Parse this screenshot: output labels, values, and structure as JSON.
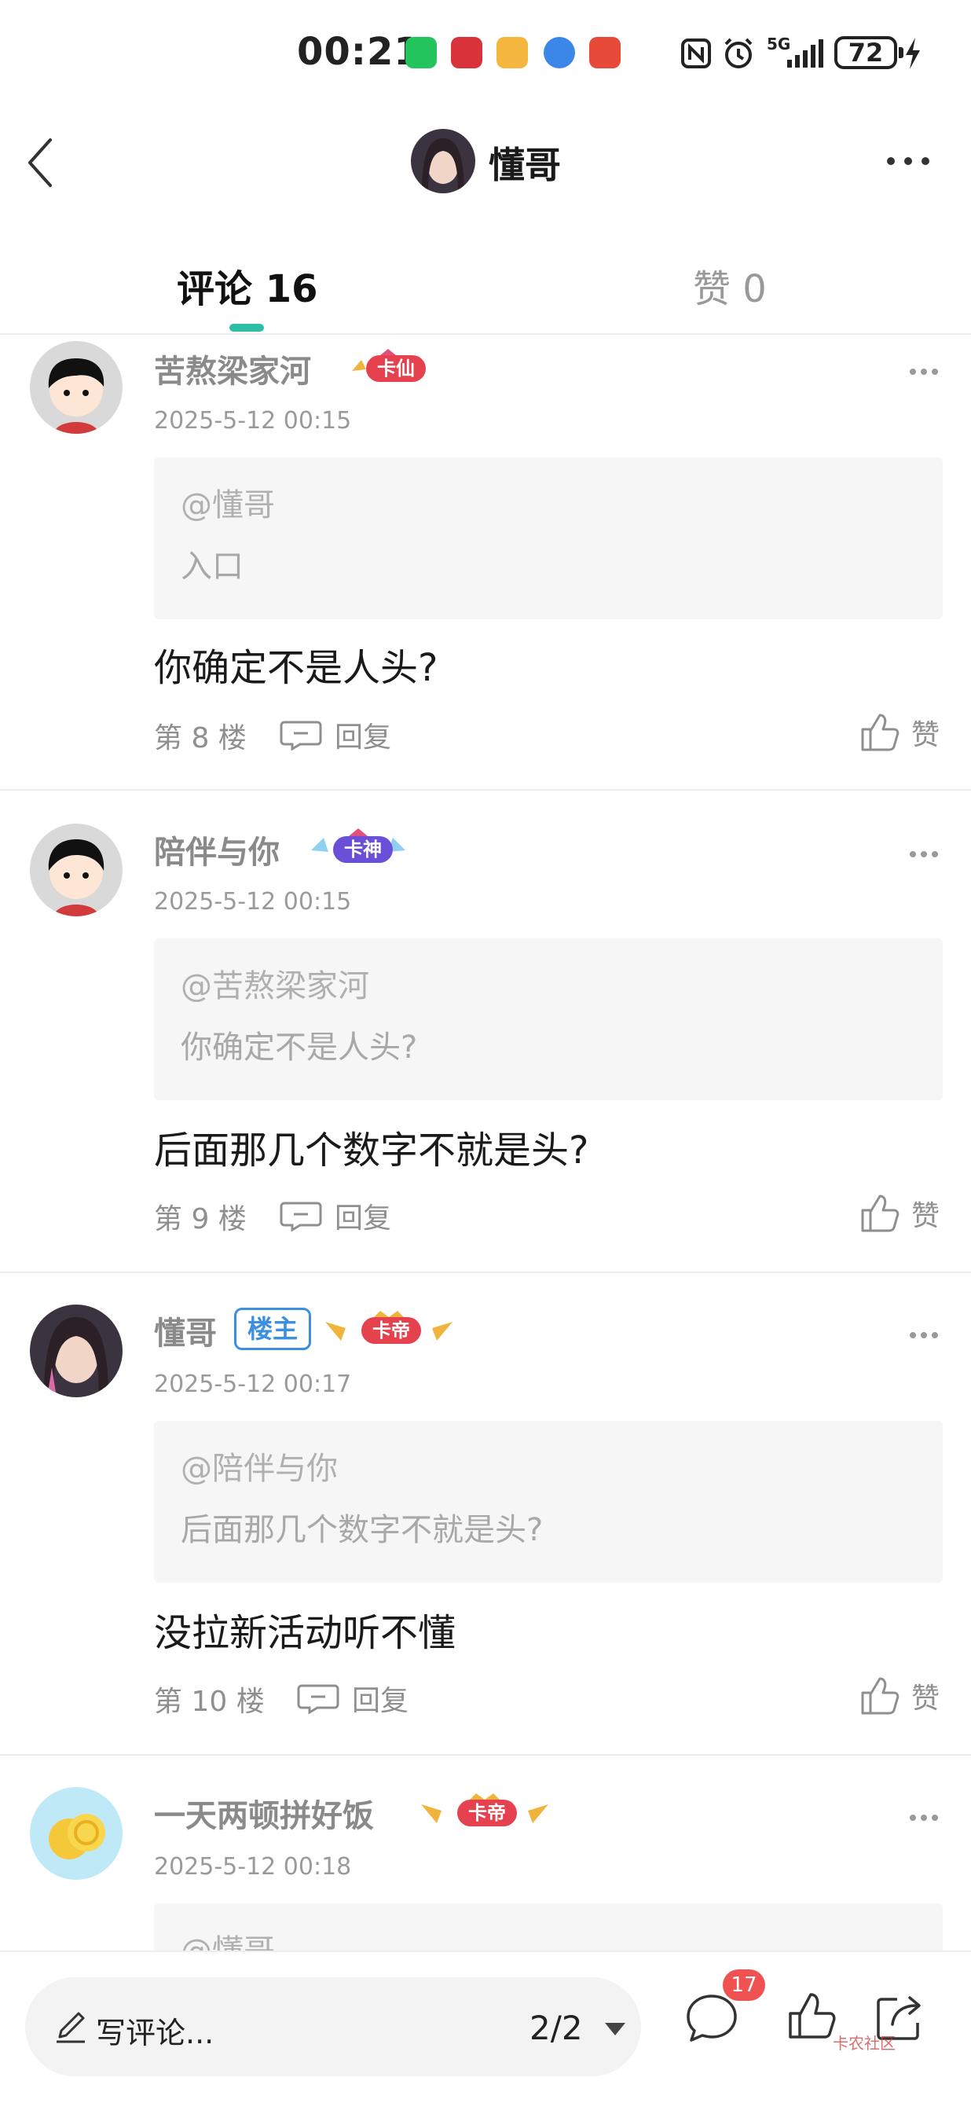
{
  "status_bar": {
    "time": "00:21",
    "battery": "72",
    "network": "5G"
  },
  "header": {
    "title": "懂哥"
  },
  "tabs": [
    {
      "label": "评论 16",
      "active": true
    },
    {
      "label": "赞 0",
      "active": false
    }
  ],
  "comments": [
    {
      "name": "苦熬梁家河",
      "rank": "卡仙",
      "time": "2025-5-12 00:15",
      "quote_at": "@懂哥",
      "quote_text": "入口",
      "text": "你确定不是人头?",
      "floor": "第 8 楼",
      "reply": "回复",
      "like": "赞"
    },
    {
      "name": "陪伴与你",
      "rank": "卡神",
      "time": "2025-5-12 00:15",
      "quote_at": "@苦熬梁家河",
      "quote_text": "你确定不是人头?",
      "text": "后面那几个数字不就是头?",
      "floor": "第 9 楼",
      "reply": "回复",
      "like": "赞"
    },
    {
      "name": "懂哥",
      "owner_badge": "楼主",
      "rank": "卡帝",
      "time": "2025-5-12 00:17",
      "quote_at": "@陪伴与你",
      "quote_text": "后面那几个数字不就是头?",
      "text": "没拉新活动听不懂",
      "floor": "第 10 楼",
      "reply": "回复",
      "like": "赞"
    },
    {
      "name": "一天两顿拼好饭",
      "rank": "卡帝",
      "time": "2025-5-12 00:18",
      "quote_at": "@懂哥"
    }
  ],
  "bottom_bar": {
    "placeholder": "写评论...",
    "page": "2/2",
    "comment_count": "17",
    "watermark": "卡农社区"
  },
  "colors": {
    "accent": "#2cbfa5",
    "owner_badge": "#3a8fe0",
    "notification": "#f05252"
  }
}
